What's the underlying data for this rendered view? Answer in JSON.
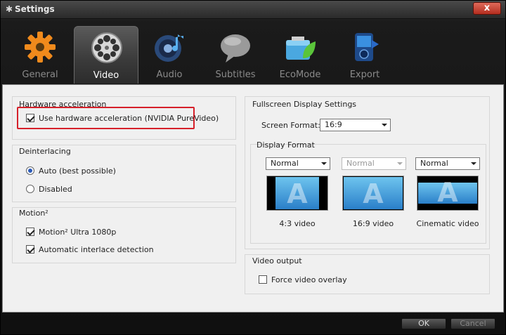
{
  "window": {
    "title": "Settings",
    "close_label": "x"
  },
  "tabs": [
    {
      "label": "General",
      "icon": "gear-icon",
      "active": false
    },
    {
      "label": "Video",
      "icon": "film-reel-icon",
      "active": true
    },
    {
      "label": "Audio",
      "icon": "speaker-note-icon",
      "active": false
    },
    {
      "label": "Subtitles",
      "icon": "speech-bubble-icon",
      "active": false
    },
    {
      "label": "EcoMode",
      "icon": "battery-leaf-icon",
      "active": false
    },
    {
      "label": "Export",
      "icon": "device-export-icon",
      "active": false
    }
  ],
  "hardware": {
    "title": "Hardware acceleration",
    "option_label": "Use hardware acceleration (NVIDIA PureVideo)",
    "option_checked": true
  },
  "deinterlacing": {
    "title": "Deinterlacing",
    "options": [
      {
        "label": "Auto (best possible)",
        "selected": true
      },
      {
        "label": "Disabled",
        "selected": false
      }
    ]
  },
  "motion": {
    "title": "Motion²",
    "options": [
      {
        "label": "Motion² Ultra 1080p",
        "checked": true
      },
      {
        "label": "Automatic interlace detection",
        "checked": true
      }
    ]
  },
  "fullscreen": {
    "title": "Fullscreen Display Settings",
    "screen_format_label": "Screen Format:",
    "screen_format_value": "16:9",
    "display_format": {
      "title": "Display Format",
      "items": [
        {
          "select_value": "Normal",
          "enabled": true,
          "label": "4:3 video"
        },
        {
          "select_value": "Normal",
          "enabled": false,
          "label": "16:9 video"
        },
        {
          "select_value": "Normal",
          "enabled": true,
          "label": "Cinematic video"
        }
      ],
      "thumb_letter": "A"
    }
  },
  "video_output": {
    "title": "Video output",
    "option_label": "Force video overlay",
    "option_checked": false
  },
  "buttons": {
    "ok": "OK",
    "cancel": "Cancel"
  },
  "colors": {
    "highlight": "#d6202a",
    "accent": "#2a7fc9"
  }
}
